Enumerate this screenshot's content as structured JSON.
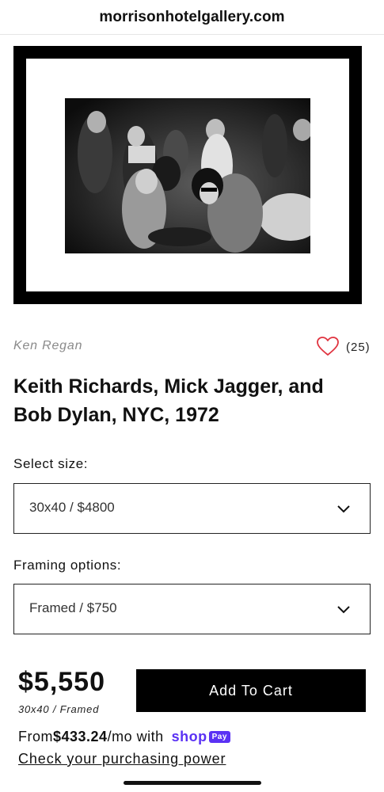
{
  "browser": {
    "url": "morrisonhotelgallery.com"
  },
  "product": {
    "artist": "Ken Regan",
    "favorites_count": "(25)",
    "title": "Keith Richards, Mick Jagger, and Bob Dylan, NYC, 1972",
    "size": {
      "label": "Select size:",
      "selected": "30x40 / $4800"
    },
    "framing": {
      "label": "Framing options:",
      "selected": "Framed / $750"
    },
    "price": "$5,550",
    "price_detail": "30x40 / Framed",
    "add_to_cart": "Add To Cart"
  },
  "financing": {
    "prefix": "From ",
    "amount": "$433.24",
    "suffix": "/mo with",
    "brand_shop": "shop",
    "brand_pay": "Pay",
    "brand_color": "#5a31f4",
    "link": "Check your purchasing power"
  },
  "icons": {
    "favorite": "heart-outline-icon",
    "heart_color": "#e0333f",
    "dropdown": "chevron-down-icon"
  }
}
